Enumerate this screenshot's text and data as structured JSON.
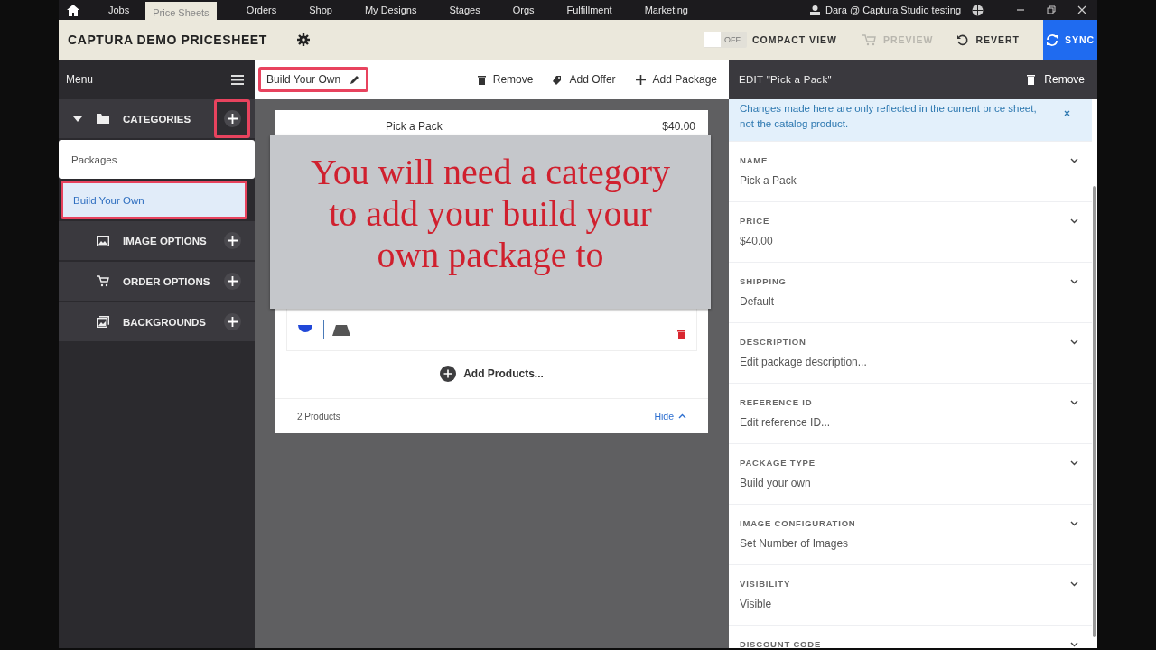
{
  "nav": {
    "tabs": [
      {
        "label": "Jobs",
        "selected": false
      },
      {
        "label": "Price Sheets",
        "selected": true
      },
      {
        "label": "Orders",
        "selected": false
      },
      {
        "label": "Shop",
        "selected": false
      },
      {
        "label": "My Designs",
        "selected": false
      },
      {
        "label": "Stages",
        "selected": false
      },
      {
        "label": "Orgs",
        "selected": false
      },
      {
        "label": "Fulfillment",
        "selected": false
      },
      {
        "label": "Marketing",
        "selected": false
      }
    ],
    "user": "Dara @ Captura Studio testing"
  },
  "header": {
    "title": "CAPTURA DEMO PRICESHEET",
    "toggle": {
      "state_label": "OFF",
      "on": false,
      "label": "COMPACT VIEW"
    },
    "preview": {
      "label": "PREVIEW",
      "disabled": true
    },
    "revert": "REVERT",
    "sync": "SYNC"
  },
  "sidebar": {
    "title": "Menu",
    "sections": [
      {
        "label": "CATEGORIES",
        "kind": "folder",
        "expanded": true,
        "add_highlighted": true,
        "children": [
          {
            "label": "Packages",
            "selected": false,
            "highlighted": false
          },
          {
            "label": "Build Your Own",
            "selected": true,
            "highlighted": true
          }
        ]
      },
      {
        "label": "IMAGE OPTIONS",
        "kind": "image",
        "expanded": false,
        "add_highlighted": false
      },
      {
        "label": "ORDER OPTIONS",
        "kind": "cart",
        "expanded": false,
        "add_highlighted": false
      },
      {
        "label": "BACKGROUNDS",
        "kind": "backgrounds",
        "expanded": false,
        "add_highlighted": false
      }
    ]
  },
  "center": {
    "category_title": "Build Your Own",
    "title_highlighted": true,
    "actions": [
      {
        "label": "Remove",
        "kind": "trash"
      },
      {
        "label": "Add Offer",
        "kind": "tag"
      },
      {
        "label": "Add Package",
        "kind": "plus"
      }
    ],
    "package": {
      "name": "Pick a Pack",
      "price": "$40.00",
      "add_products": "Add Products...",
      "count": "2 Products",
      "toggle": "Hide"
    },
    "callout": "You will need a category to add your build your own package to"
  },
  "editor": {
    "title": "EDIT \"Pick a Pack\"",
    "remove": "Remove",
    "notice": "Changes made here are only reflected in the current price sheet, not the catalog product.",
    "fields": [
      {
        "label": "NAME",
        "value": "Pick a Pack"
      },
      {
        "label": "PRICE",
        "value": "$40.00"
      },
      {
        "label": "SHIPPING",
        "value": "Default"
      },
      {
        "label": "DESCRIPTION",
        "value": "Edit package description..."
      },
      {
        "label": "REFERENCE ID",
        "value": "Edit reference ID..."
      },
      {
        "label": "PACKAGE TYPE",
        "value": "Build your own"
      },
      {
        "label": "IMAGE CONFIGURATION",
        "value": "Set Number of Images"
      },
      {
        "label": "VISIBILITY",
        "value": "Visible"
      },
      {
        "label": "DISCOUNT CODE"
      }
    ]
  }
}
